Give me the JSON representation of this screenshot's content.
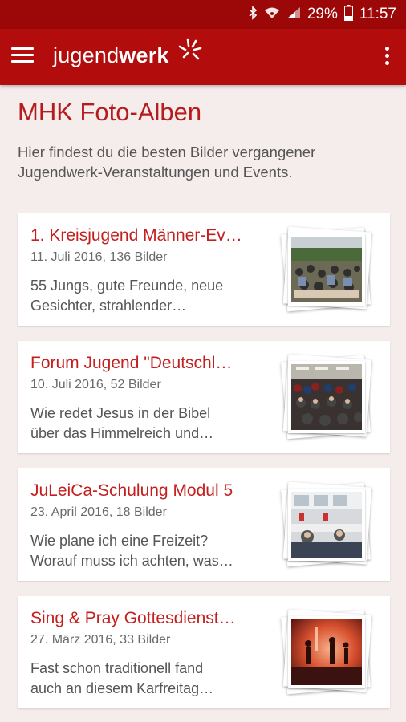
{
  "status_bar": {
    "battery_percent": "29%",
    "time": "11:57",
    "icons": [
      "bluetooth-icon",
      "wifi-icon",
      "signal-icon",
      "battery-icon"
    ]
  },
  "app_bar": {
    "logo_regular": "jugend",
    "logo_bold": "werk",
    "colors": {
      "status_bar": "#9c0707",
      "app_bar": "#b30c0c",
      "accent": "#c41e1e"
    }
  },
  "page": {
    "title": "MHK Foto-Alben",
    "intro": "Hier findest du die besten Bilder vergangener Jugendwerk-Veranstaltungen und Events."
  },
  "albums": [
    {
      "title": "1. Kreisjugend Männer-Ev…",
      "meta": "11. Juli 2016, 136 Bilder",
      "desc_line1": "55 Jungs, gute Freunde, neue",
      "desc_line2": "Gesichter, strahlender…"
    },
    {
      "title": "Forum Jugend \"Deutschl…",
      "meta": "10. Juli 2016, 52 Bilder",
      "desc_line1": "Wie redet Jesus in der Bibel",
      "desc_line2": "über das Himmelreich und…"
    },
    {
      "title": "JuLeiCa-Schulung Modul 5",
      "meta": "23. April 2016, 18 Bilder",
      "desc_line1": "Wie plane ich eine Freizeit?",
      "desc_line2": "Worauf muss ich achten, was…"
    },
    {
      "title": "Sing & Pray Gottesdienst…",
      "meta": "27. März 2016, 33 Bilder",
      "desc_line1": "Fast schon traditionell fand",
      "desc_line2": "auch an diesem Karfreitag…"
    }
  ]
}
